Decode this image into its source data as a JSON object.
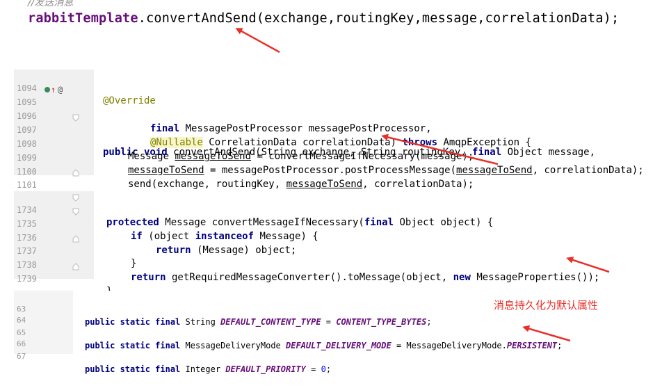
{
  "top": {
    "comment": "//发送消息",
    "call_field": "rabbitTemplate",
    "call_rest": ".convertAndSend(exchange,routingKey,message,correlationData);"
  },
  "panel1": {
    "lines": [
      {
        "num": "1094",
        "text": "@Override"
      },
      {
        "num": "1095",
        "text": "public void convertAndSend(String exchange, String routingKey, final Object message,"
      },
      {
        "num": "1096",
        "text": "final MessagePostProcessor messagePostProcessor,"
      },
      {
        "num": "1097",
        "text": "@Nullable CorrelationData correlationData) throws AmqpException {"
      },
      {
        "num": "1098",
        "text": "Message messageToSend = convertMessageIfNecessary(message);"
      },
      {
        "num": "1099",
        "text": "messageToSend = messagePostProcessor.postProcessMessage(messageToSend, correlationData);"
      },
      {
        "num": "1100",
        "text": "send(exchange, routingKey, messageToSend, correlationData);"
      },
      {
        "num": "1101",
        "text": "}"
      }
    ]
  },
  "panel2": {
    "lines": [
      {
        "num": "1734",
        "text": "protected Message convertMessageIfNecessary(final Object object) {"
      },
      {
        "num": "1735",
        "text": "if (object instanceof Message) {"
      },
      {
        "num": "1736",
        "text": "return (Message) object;"
      },
      {
        "num": "1737",
        "text": "}"
      },
      {
        "num": "1738",
        "text": "return getRequiredMessageConverter().toMessage(object, new MessageProperties());"
      },
      {
        "num": "1739",
        "text": "}"
      }
    ]
  },
  "panel3": {
    "lines": [
      {
        "num": "63",
        "text": "public static final String DEFAULT_CONTENT_TYPE = CONTENT_TYPE_BYTES;"
      },
      {
        "num": "64",
        "text": ""
      },
      {
        "num": "65",
        "text": "public static final MessageDeliveryMode DEFAULT_DELIVERY_MODE = MessageDeliveryMode.PERSISTENT;"
      },
      {
        "num": "66",
        "text": ""
      },
      {
        "num": "67",
        "text": "public static final Integer DEFAULT_PRIORITY = 0;"
      }
    ]
  },
  "annotation_note": "消息持久化为默认属性",
  "colors": {
    "keyword": "#000080",
    "annotation": "#808000",
    "constant": "#660e7a",
    "arrow": "#e8302a",
    "gutter": "#f0f0f0"
  }
}
